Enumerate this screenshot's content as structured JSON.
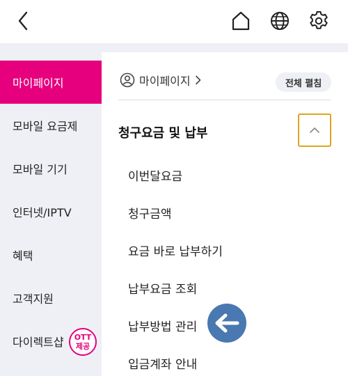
{
  "header": {
    "back_icon": "back-arrow-icon",
    "home_icon": "home-icon",
    "language_icon": "globe-icon",
    "settings_icon": "gear-icon"
  },
  "sidebar": {
    "items": [
      {
        "label": "마이페이지",
        "active": true
      },
      {
        "label": "모바일 요금제"
      },
      {
        "label": "모바일 기기"
      },
      {
        "label": "인터넷/IPTV"
      },
      {
        "label": "혜택"
      },
      {
        "label": "고객지원"
      },
      {
        "label": "다이렉트샵",
        "badge": {
          "line1": "OTT",
          "line2": "제공"
        }
      }
    ]
  },
  "main": {
    "breadcrumb": "마이페이지",
    "expand_all_label": "전체 펼침",
    "section": {
      "title": "청구요금 및 납부",
      "items": [
        {
          "label": "이번달요금"
        },
        {
          "label": "청구금액"
        },
        {
          "label": "요금 바로 납부하기"
        },
        {
          "label": "납부요금 조회"
        },
        {
          "label": "납부방법 관리"
        },
        {
          "label": "입금계좌 안내"
        }
      ]
    }
  },
  "colors": {
    "accent": "#e6007e",
    "sidebar_bg": "#eef0f5",
    "focus_outline": "#e0a31e",
    "pointer": "#4a78b0"
  }
}
